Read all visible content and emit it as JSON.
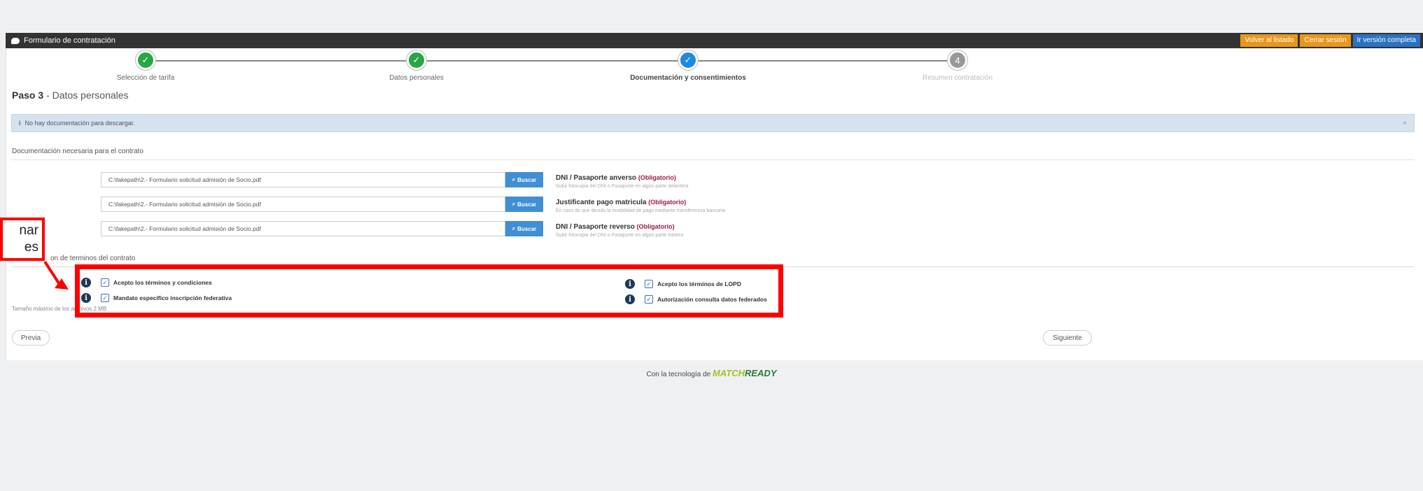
{
  "topbar": {
    "title": "Formulario de contratación",
    "back_label": "Volver al listado",
    "logout_label": "Cerrar sesión",
    "full_label": "Ir versión completa"
  },
  "steps": [
    {
      "label": "Selección de tarifa",
      "state": "done",
      "mark": "✓"
    },
    {
      "label": "Datos personales",
      "state": "done",
      "mark": "✓"
    },
    {
      "label": "Documentación y consentimientos",
      "state": "active",
      "mark": "✓"
    },
    {
      "label": "Resumen contratación",
      "state": "pending",
      "mark": "4"
    }
  ],
  "heading": {
    "step": "Paso 3",
    "sep": " - ",
    "title": "Datos personales"
  },
  "alert": {
    "text": "No hay documentación para descargar.",
    "close": "×"
  },
  "documents": {
    "section_title": "Documentación necesaria para el contrato",
    "browse_label": "Buscar",
    "items": [
      {
        "path": "C:\\fakepath\\2.- Formulario solicitud admisión de Socio.pdf",
        "label": "DNI / Pasaporte anverso",
        "required": "(Obligatorio)",
        "help": "Subir fotocopia del DNI o Pasaporte en algún parte delantera"
      },
      {
        "path": "C:\\fakepath\\2.- Formulario solicitud admisión de Socio.pdf",
        "label": "Justificante pago matricula",
        "required": "(Obligatorio)",
        "help": "En caso de que decida la modalidad de pago mediante transferencia bancaria"
      },
      {
        "path": "C:\\fakepath\\2.- Formulario solicitud admisión de Socio.pdf",
        "label": "DNI / Pasaporte reverso",
        "required": "(Obligatorio)",
        "help": "Subir fotocopia del DNI o Pasaporte en algún parte trasera"
      }
    ]
  },
  "terms": {
    "section_title": "on de terminos del contrato",
    "items": [
      {
        "label": "Acepto los términos y condiciones",
        "checked": true
      },
      {
        "label": "Mandato específico inscripción federativa",
        "checked": true
      },
      {
        "label": "Acepto los términos de LOPD",
        "checked": true
      },
      {
        "label": "Autorización consulta datos federados",
        "checked": true
      }
    ]
  },
  "max_size": "Tamaño máximo de los archivos 2 MB",
  "nav": {
    "prev": "Previa",
    "next": "Siguiente"
  },
  "footer": {
    "prefix": "Con la tecnología de",
    "brand_a": "MATCH",
    "brand_b": "READY"
  },
  "callout": {
    "line1": "nar",
    "line2": "es"
  },
  "colors": {
    "highlight": "#ff0000",
    "topbar": "#333333",
    "accent_blue": "#1e88e5",
    "done_green": "#28a745",
    "required": "#a3164d"
  }
}
